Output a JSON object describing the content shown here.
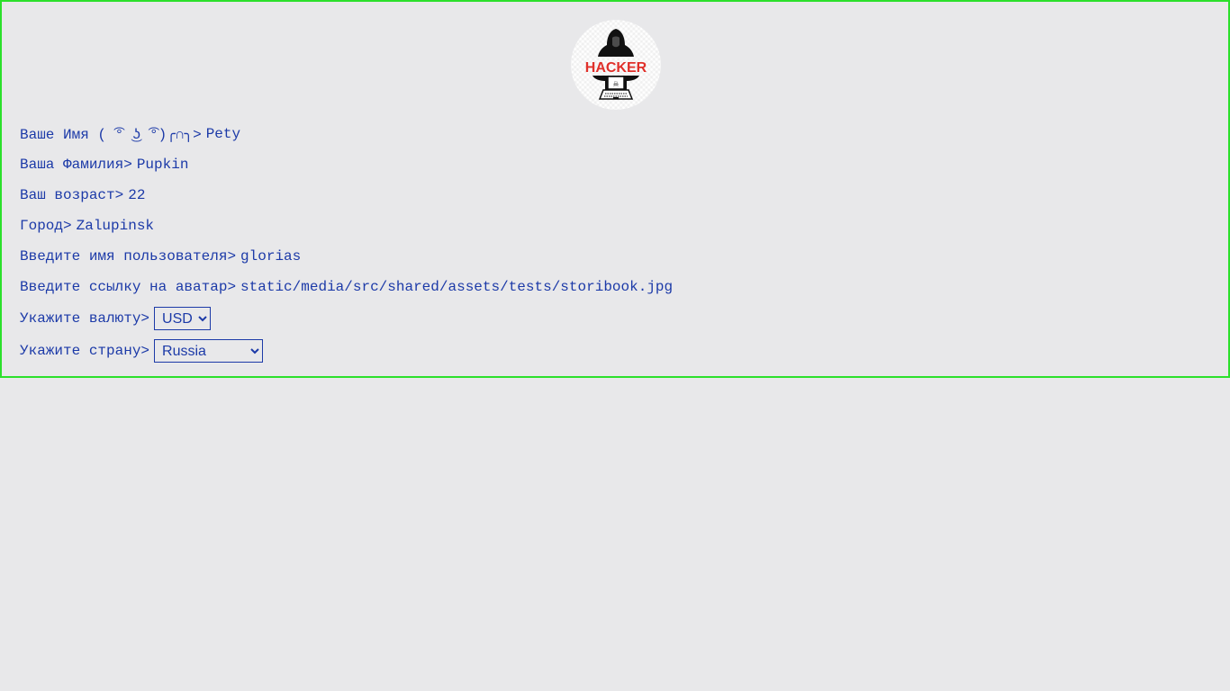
{
  "profile": {
    "avatar_logo_text": "HACKER",
    "fields": [
      {
        "label": "Ваше Имя ( ͡° ͜ʖ ͡°)╭∩╮>",
        "value": "Pety"
      },
      {
        "label": "Ваша Фамилия>",
        "value": "Pupkin"
      },
      {
        "label": "Ваш возраст>",
        "value": "22"
      },
      {
        "label": "Город>",
        "value": "Zalupinsk"
      },
      {
        "label": "Введите имя пользователя>",
        "value": "glorias"
      },
      {
        "label": "Введите ссылку на аватар>",
        "value": "static/media/src/shared/assets/tests/storibook.jpg"
      }
    ],
    "currency": {
      "label": "Укажите валюту>",
      "selected": "USD"
    },
    "country": {
      "label": "Укажите страну>",
      "selected": "Russia"
    }
  },
  "colors": {
    "text": "#1c3aa8",
    "border": "#2be02b",
    "background": "#e8e8ea",
    "logo_red": "#e0302a"
  }
}
